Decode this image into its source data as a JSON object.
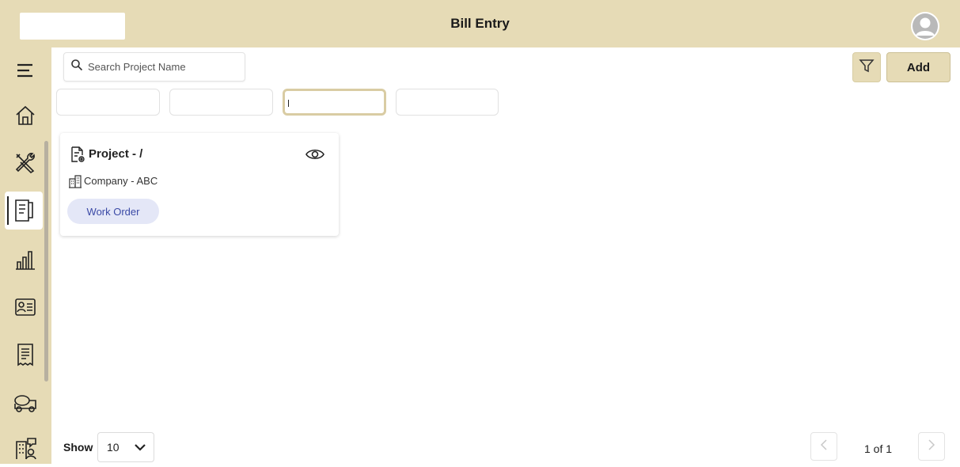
{
  "header": {
    "title": "Bill Entry",
    "logo_icon": "blank-logo",
    "avatar_icon": "user-avatar-icon"
  },
  "sidebar": {
    "items": [
      {
        "icon": "menu-icon",
        "active": false
      },
      {
        "icon": "home-icon",
        "active": false
      },
      {
        "icon": "tools-icon",
        "active": false
      },
      {
        "icon": "bill-document-icon",
        "active": true
      },
      {
        "icon": "bar-chart-icon",
        "active": false
      },
      {
        "icon": "id-card-icon",
        "active": false
      },
      {
        "icon": "receipt-icon",
        "active": false
      },
      {
        "icon": "concrete-mixer-icon",
        "active": false
      },
      {
        "icon": "building-user-icon",
        "active": false
      }
    ]
  },
  "toolbar": {
    "search_placeholder": "Search Project Name",
    "search_value": "",
    "filter_icon": "filter-icon",
    "add_label": "Add"
  },
  "tabs": [
    {
      "label": "",
      "active": false
    },
    {
      "label": "",
      "active": false
    },
    {
      "label": "",
      "active": true
    },
    {
      "label": "",
      "active": false
    }
  ],
  "cards": [
    {
      "title": "Project - /",
      "company": "Company - ABC",
      "badge": "Work Order",
      "view_icon": "eye-icon"
    }
  ],
  "footer": {
    "show_label": "Show",
    "page_size": "10",
    "page_info": "1 of 1"
  },
  "colors": {
    "brand": "#e6dbb6",
    "badge_bg": "#e4e7f7",
    "badge_text": "#3b4aa6"
  }
}
